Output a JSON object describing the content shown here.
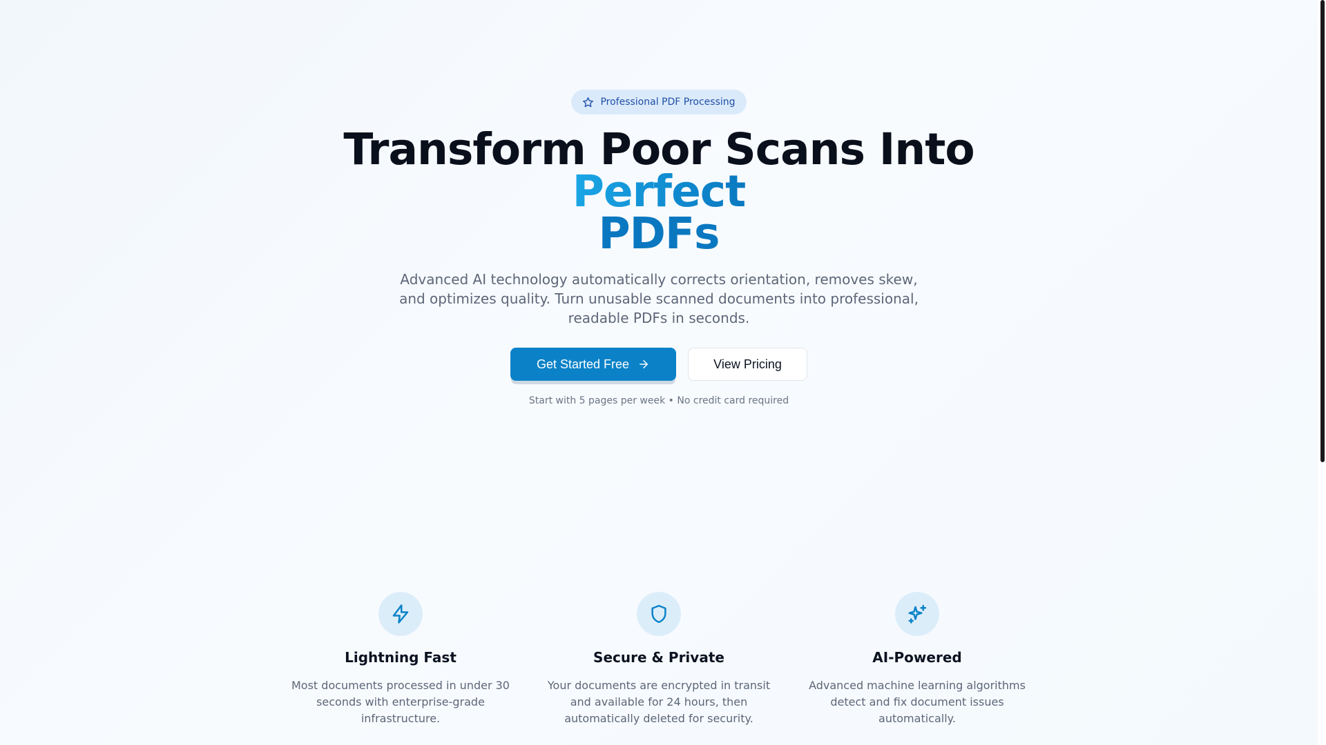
{
  "hero": {
    "badge_label": "Professional PDF Processing",
    "badge_icon": "star-icon",
    "headline_prefix": "Transform Poor Scans Into ",
    "headline_accent_1": "Perfect",
    "headline_accent_2": "PDFs",
    "subtitle": "Advanced AI technology automatically corrects orientation, removes skew, and optimizes quality. Turn unusable scanned documents into professional, readable PDFs in seconds.",
    "primary_cta": "Get Started Free",
    "secondary_cta": "View Pricing",
    "fine_print": "Start with 5 pages per week • No credit card required"
  },
  "features": [
    {
      "icon": "lightning-icon",
      "title": "Lightning Fast",
      "description": "Most documents processed in under 30 seconds with enterprise-grade infrastructure."
    },
    {
      "icon": "shield-icon",
      "title": "Secure & Private",
      "description": "Your documents are encrypted in transit and available for 24 hours, then automatically deleted for security."
    },
    {
      "icon": "sparkles-icon",
      "title": "AI-Powered",
      "description": "Advanced machine learning algorithms detect and fix document issues automatically."
    }
  ],
  "colors": {
    "primary": "#0b82c7",
    "accent_gradient_start": "#1aa6e6",
    "accent_gradient_end": "#0a78c0",
    "badge_bg": "#dbeafb",
    "badge_text": "#1e4fa6",
    "icon_circle_bg": "#dcedfa"
  }
}
